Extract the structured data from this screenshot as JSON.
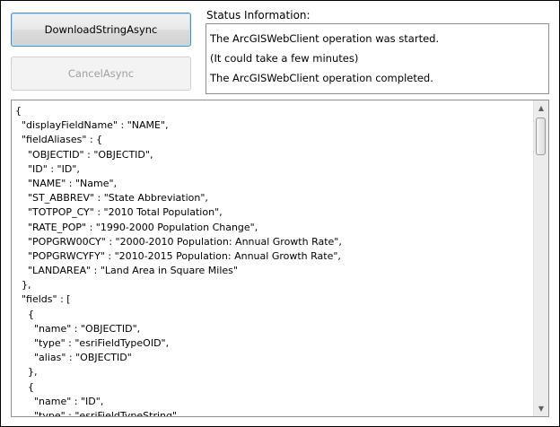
{
  "buttons": {
    "download_label": "DownloadStringAsync",
    "cancel_label": "CancelAsync"
  },
  "status": {
    "label": "Status Information:",
    "lines": [
      "The ArcGISWebClient operation was started.",
      "(It could take a few minutes)",
      "The ArcGISWebClient operation completed."
    ]
  },
  "json_output": {
    "lines": [
      "{",
      "  \"displayFieldName\" : \"NAME\",",
      "  \"fieldAliases\" : {",
      "    \"OBJECTID\" : \"OBJECTID\",",
      "    \"ID\" : \"ID\",",
      "    \"NAME\" : \"Name\",",
      "    \"ST_ABBREV\" : \"State Abbreviation\",",
      "    \"TOTPOP_CY\" : \"2010 Total Population\",",
      "    \"RATE_POP\" : \"1990-2000 Population Change\",",
      "    \"POPGRW00CY\" : \"2000-2010 Population: Annual Growth Rate\",",
      "    \"POPGRWCYFY\" : \"2010-2015 Population: Annual Growth Rate\",",
      "    \"LANDAREA\" : \"Land Area in Square Miles\"",
      "  },",
      "  \"fields\" : [",
      "    {",
      "      \"name\" : \"OBJECTID\",",
      "      \"type\" : \"esriFieldTypeOID\",",
      "      \"alias\" : \"OBJECTID\"",
      "    },",
      "    {",
      "      \"name\" : \"ID\",",
      "      \"type\" : \"esriFieldTypeString\","
    ]
  },
  "icons": {
    "scroll_up": "▲",
    "scroll_down": "▼"
  }
}
